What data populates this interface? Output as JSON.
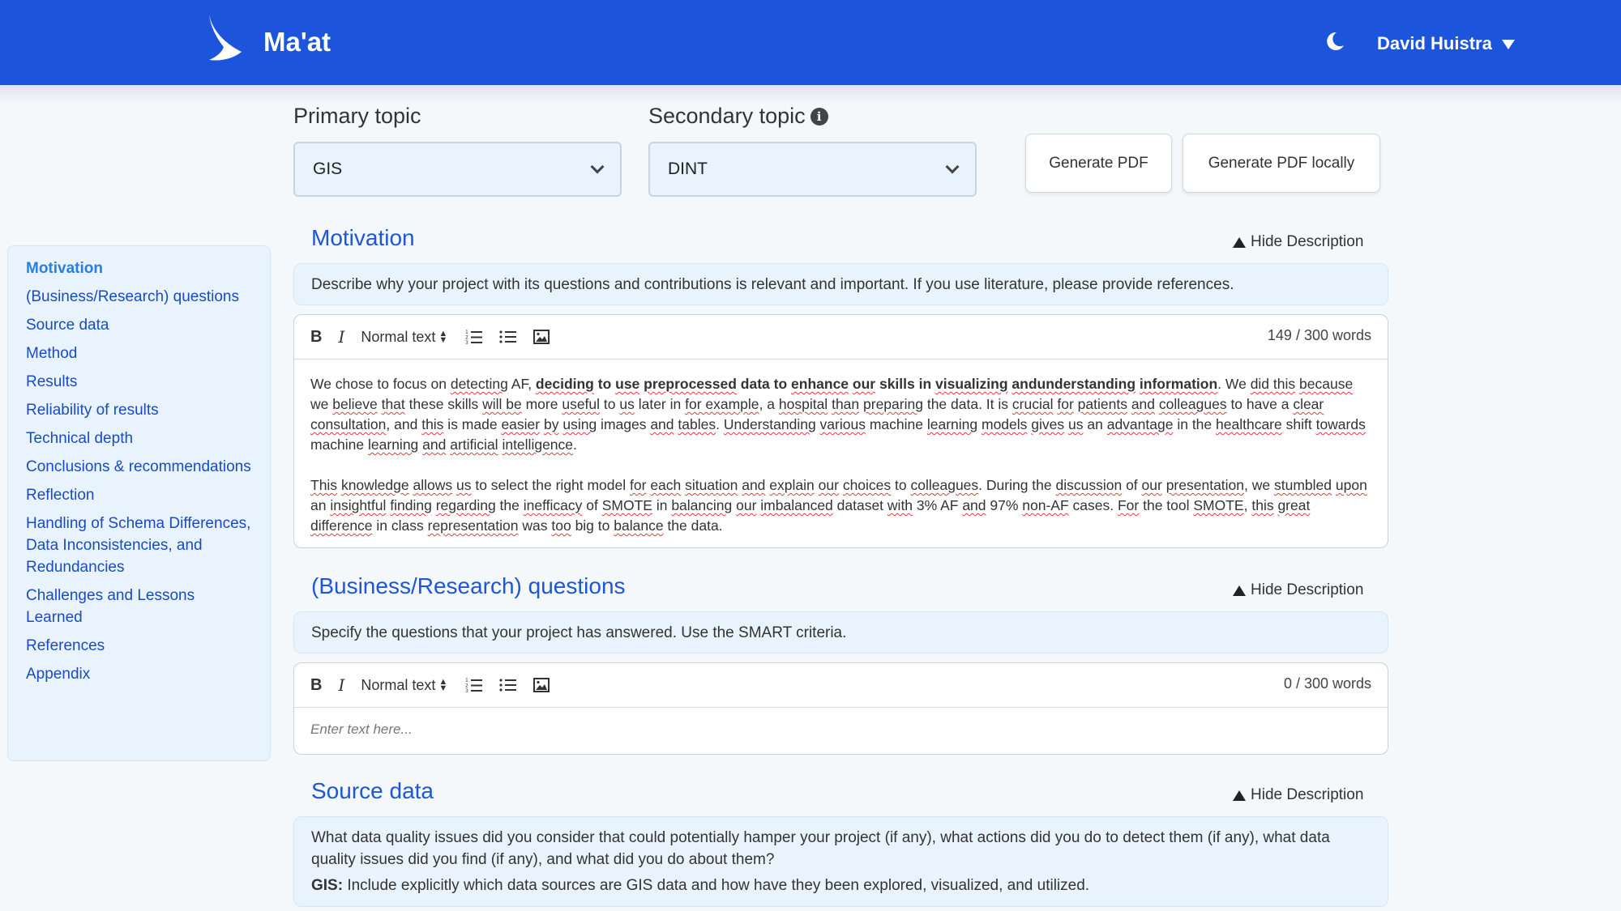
{
  "header": {
    "app_title": "Ma'at",
    "user_name": "David Huistra"
  },
  "sidebar": {
    "items": [
      "Motivation",
      "(Business/Research) questions",
      "Source data",
      "Method",
      "Results",
      "Reliability of results",
      "Technical depth",
      "Conclusions & recommendations",
      "Reflection",
      "Handling of Schema Differences, Data Inconsistencies, and Redundancies",
      "Challenges and Lessons Learned",
      "References",
      "Appendix"
    ]
  },
  "topics": {
    "primary_label": "Primary topic",
    "primary_value": "GIS",
    "secondary_label": "Secondary topic",
    "secondary_value": "DINT"
  },
  "actions": {
    "generate_pdf": "Generate PDF",
    "generate_pdf_locally": "Generate PDF locally"
  },
  "toolbar": {
    "bold": "B",
    "italic": "I",
    "format": "Normal text"
  },
  "sections": [
    {
      "title": "Motivation",
      "hide_label": "Hide Description",
      "description": "Describe why your project with its questions and contributions is relevant and important. If you use literature, please provide references.",
      "word_count": "149 / 300 words"
    },
    {
      "title": "(Business/Research) questions",
      "hide_label": "Hide Description",
      "description": "Specify the questions that your project has answered. Use the SMART criteria.",
      "word_count": "0 / 300 words",
      "placeholder": "Enter text here..."
    },
    {
      "title": "Source data",
      "hide_label": "Hide Description",
      "description": "What data quality issues did you consider that could potentially hamper your project (if any), what actions did you do to detect them (if any), what data quality issues did you find (if any), and what did you do about them?",
      "gis_label": "GIS:",
      "gis_text": " Include explicitly which data sources are GIS data and how have they been explored, visualized, and utilized."
    }
  ],
  "colors": {
    "header": "#1c55dc",
    "section_title": "#1d57d6",
    "sidebar_link": "#1a4bc4",
    "panel_bg": "#e8f3fd"
  }
}
